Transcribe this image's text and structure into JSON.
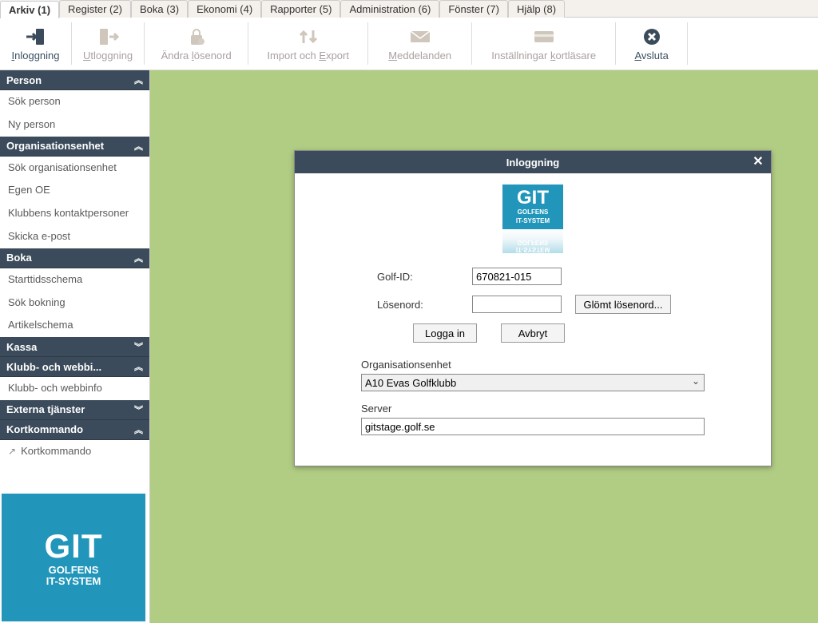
{
  "menu_tabs": [
    {
      "label": "Arkiv (1)",
      "active": true
    },
    {
      "label": "Register (2)",
      "active": false
    },
    {
      "label": "Boka (3)",
      "active": false
    },
    {
      "label": "Ekonomi (4)",
      "active": false
    },
    {
      "label": "Rapporter (5)",
      "active": false
    },
    {
      "label": "Administration (6)",
      "active": false
    },
    {
      "label": "Fönster (7)",
      "active": false
    },
    {
      "label": "Hjälp (8)",
      "active": false
    }
  ],
  "toolbar": {
    "login": {
      "label": "Inloggning",
      "enabled": true
    },
    "logout": {
      "label": "Utloggning",
      "enabled": false
    },
    "change_pw": {
      "label": "Ändra lösenord",
      "enabled": false
    },
    "import_export": {
      "label": "Import och Export",
      "enabled": false
    },
    "messages": {
      "label": "Meddelanden",
      "enabled": false
    },
    "cardreader": {
      "label": "Inställningar kortläsare",
      "enabled": false
    },
    "quit": {
      "label": "Avsluta",
      "enabled": true
    }
  },
  "sidebar": {
    "person": {
      "title": "Person",
      "items": [
        "Sök person",
        "Ny person"
      ]
    },
    "org": {
      "title": "Organisationsenhet",
      "items": [
        "Sök organisationsenhet",
        "Egen OE",
        "Klubbens kontaktpersoner",
        "Skicka e-post"
      ]
    },
    "boka": {
      "title": "Boka",
      "items": [
        "Starttidsschema",
        "Sök bokning",
        "Artikelschema"
      ]
    },
    "kassa": {
      "title": "Kassa"
    },
    "klubb": {
      "title": "Klubb- och webbi...",
      "items": [
        "Klubb- och webbinfo"
      ]
    },
    "externa": {
      "title": "Externa tjänster"
    },
    "kortkom": {
      "title": "Kortkommando",
      "items": [
        "Kortkommando"
      ]
    }
  },
  "logo": {
    "title": "GIT",
    "line1": "GOLFENS",
    "line2": "IT-SYSTEM"
  },
  "dialog": {
    "title": "Inloggning",
    "golf_id_label": "Golf-ID:",
    "golf_id_value": "670821-015",
    "password_label": "Lösenord:",
    "password_value": "",
    "forgot_label": "Glömt lösenord...",
    "login_label": "Logga in",
    "cancel_label": "Avbryt",
    "org_label": "Organisationsenhet",
    "org_selected": "A10 Evas Golfklubb",
    "server_label": "Server",
    "server_value": "gitstage.golf.se"
  }
}
